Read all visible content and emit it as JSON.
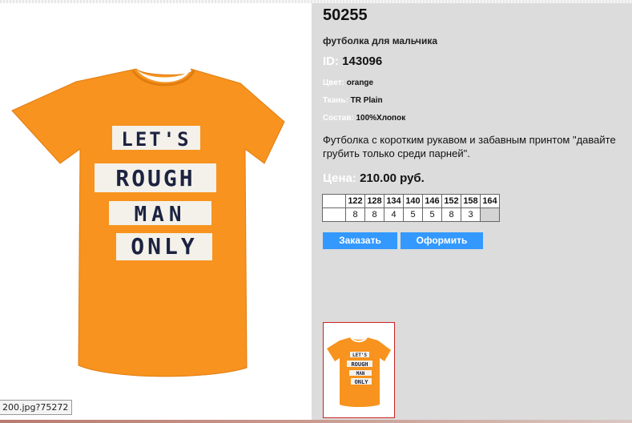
{
  "product": {
    "article": "50255",
    "subtitle": "футболка для мальчика",
    "id_label": "ID:",
    "id_value": "143096",
    "color_label": "Цвет:",
    "color_value": "orange",
    "fabric_label": "Ткань:",
    "fabric_value": "TR Plain",
    "composition_label": "Состав:",
    "composition_value": "100%Хлопок",
    "description": "Футболка с коротким рукавом и забавным принтом \"давайте грубить только среди парней\".",
    "price_label": "Цена:",
    "price_value": "210.00 руб."
  },
  "shirt_print": {
    "line1": "LET'S",
    "line2": "ROUGH",
    "line3": "MAN",
    "line4": "ONLY",
    "shirt_color": "#f7931e",
    "print_text_color": "#1c2340"
  },
  "sizes": {
    "headers": [
      "122",
      "128",
      "134",
      "140",
      "146",
      "152",
      "158",
      "164"
    ],
    "quantities": [
      "8",
      "8",
      "4",
      "5",
      "5",
      "8",
      "3",
      ""
    ]
  },
  "buttons": {
    "order": "Заказать",
    "checkout": "Оформить"
  },
  "statusbar": {
    "text": "200.jpg?75272"
  },
  "colors": {
    "panel_bg": "#dcdcdc",
    "button_bg": "#3399ff",
    "thumb_border": "#cc2222"
  }
}
